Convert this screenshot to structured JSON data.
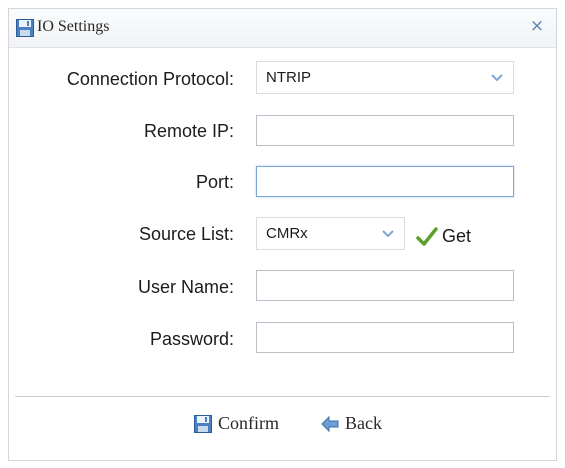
{
  "window": {
    "title": "IO Settings",
    "close_symbol": "×",
    "icon": "save-disk-icon"
  },
  "form": {
    "connection_protocol": {
      "label": "Connection Protocol:",
      "value": "NTRIP"
    },
    "remote_ip": {
      "label": "Remote IP:",
      "value": ""
    },
    "port": {
      "label": "Port:",
      "value": ""
    },
    "source_list": {
      "label": "Source List:",
      "value": "CMRx",
      "get_label": "Get"
    },
    "user_name": {
      "label": "User Name:",
      "value": ""
    },
    "password": {
      "label": "Password:",
      "value": ""
    }
  },
  "footer": {
    "confirm_label": "Confirm",
    "back_label": "Back"
  },
  "colors": {
    "accent": "#5d84b4",
    "check": "#5aa02c",
    "focus_border": "#7aa7d8"
  }
}
